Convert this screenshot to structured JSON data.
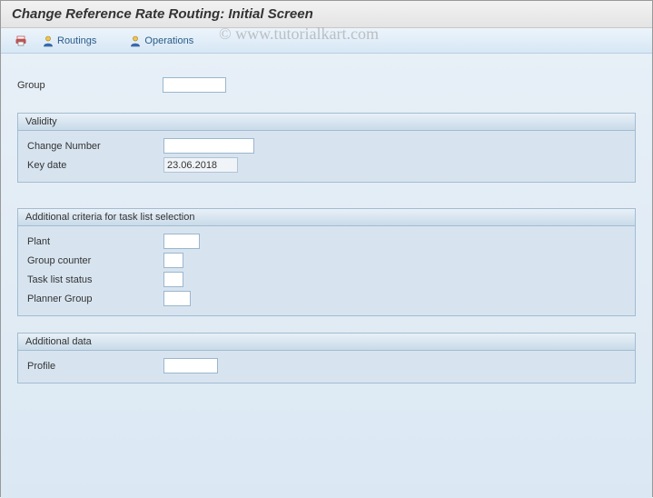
{
  "title": "Change Reference Rate Routing: Initial Screen",
  "watermark": "© www.tutorialkart.com",
  "toolbar": {
    "print_label": "",
    "routings_label": "Routings",
    "operations_label": "Operations"
  },
  "top_fields": {
    "group_label": "Group",
    "group_value": ""
  },
  "validity": {
    "header": "Validity",
    "change_number_label": "Change Number",
    "change_number_value": "",
    "key_date_label": "Key date",
    "key_date_value": "23.06.2018"
  },
  "criteria": {
    "header": "Additional criteria for task list selection",
    "plant_label": "Plant",
    "plant_value": "",
    "group_counter_label": "Group counter",
    "group_counter_value": "",
    "status_label": "Task list status",
    "status_value": "",
    "planner_label": "Planner Group",
    "planner_value": ""
  },
  "additional": {
    "header": "Additional data",
    "profile_label": "Profile",
    "profile_value": ""
  }
}
